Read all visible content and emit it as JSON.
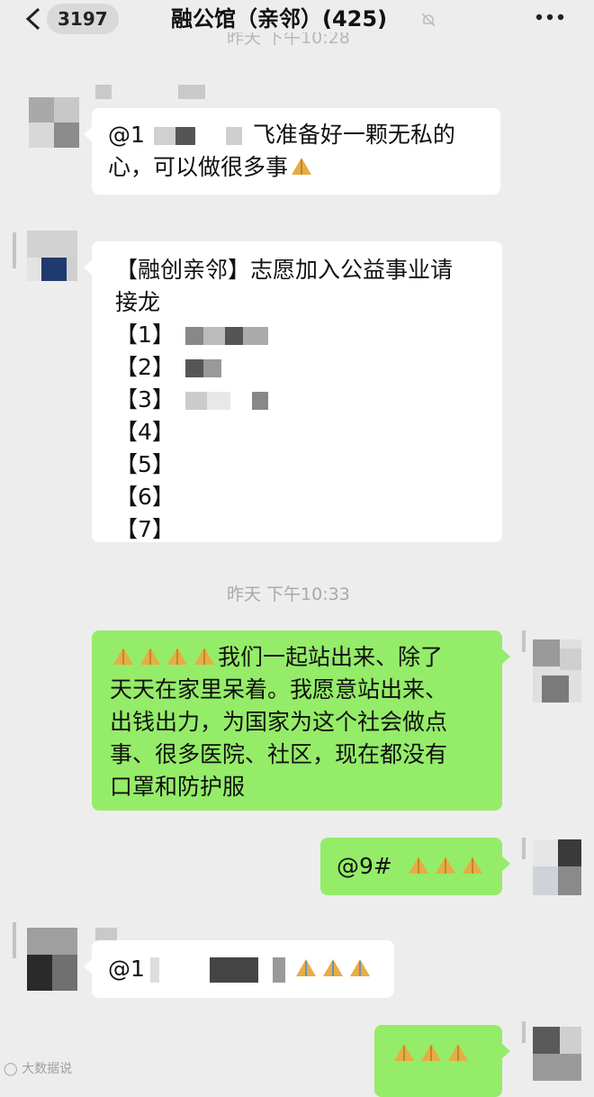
{
  "header": {
    "unread_count": "3197",
    "title": "融公馆（亲邻）(425)"
  },
  "messages": {
    "m1": {
      "text_prefix": "@1",
      "text_after_mosaic": "飞准备好一颗无私的",
      "line2": "心，可以做很多事"
    },
    "m2": {
      "title_line1": "【融创亲邻】志愿加入公益事业请",
      "title_line2": "接龙",
      "items": [
        "【1】",
        "【2】",
        "【3】",
        "【4】",
        "【5】",
        "【6】",
        "【7】"
      ]
    },
    "time_separator": "昨天 下午10:33",
    "m3": {
      "line1": "我们一起站出来、除了",
      "line2": "天天在家里呆着。我愿意站出来、",
      "line3": "出钱出力，为国家为这个社会做点",
      "line4": "事、很多医院、社区，现在都没有",
      "line5": "口罩和防护服"
    },
    "m4": {
      "text": "@9#"
    },
    "m5": {
      "text_prefix": "@1"
    }
  },
  "watermark": {
    "text": "大数据说"
  },
  "colors": {
    "background": "#ededed",
    "bubble_white": "#ffffff",
    "bubble_green": "#95ec69",
    "emoji_hands": "#e6ad45"
  },
  "icons": [
    "back-chevron-icon",
    "mute-bell-icon",
    "more-dots-icon",
    "folded-hands-emoji"
  ]
}
